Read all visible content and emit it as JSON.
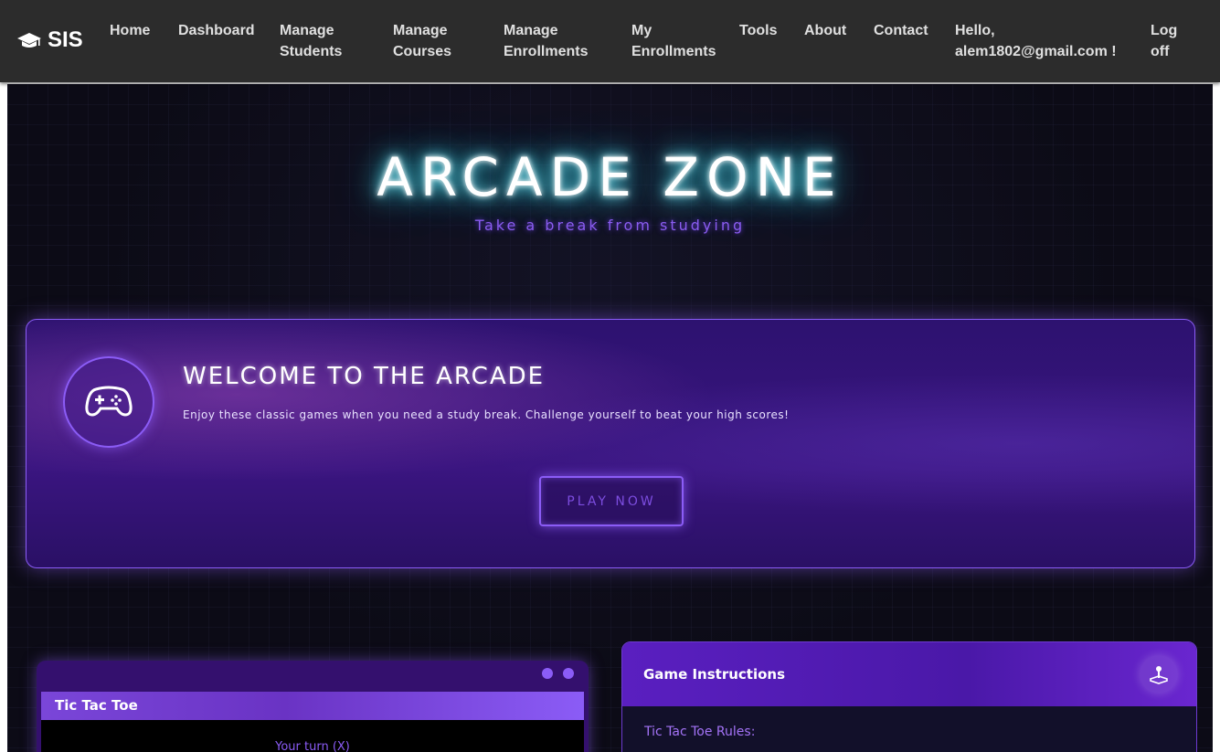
{
  "navbar": {
    "brand": "SIS",
    "items": [
      {
        "label": "Home"
      },
      {
        "label": "Dashboard"
      },
      {
        "label": "Manage\nStudents"
      },
      {
        "label": "Manage\nCourses"
      },
      {
        "label": "Manage\nEnrollments"
      },
      {
        "label": "My\nEnrollments"
      },
      {
        "label": "Tools"
      },
      {
        "label": "About"
      },
      {
        "label": "Contact"
      }
    ],
    "greeting": "Hello,\nalem1802@gmail.com !",
    "logoff": "Log\noff"
  },
  "hero": {
    "title": "ARCADE ZONE",
    "subtitle": "Take a break from studying"
  },
  "welcome": {
    "title": "WELCOME TO THE ARCADE",
    "description": "Enjoy these classic games when you need a study break. Challenge yourself to beat your high scores!",
    "button": "PLAY NOW"
  },
  "game": {
    "title": "Tic Tac Toe",
    "turn": "Your turn (X)"
  },
  "instructions": {
    "title": "Game Instructions",
    "rules_title": "Tic Tac Toe Rules:"
  },
  "colors": {
    "accent": "#8b5cf6",
    "neon_cyan": "#36d8e8",
    "navbar_bg": "#2c2c2c"
  }
}
